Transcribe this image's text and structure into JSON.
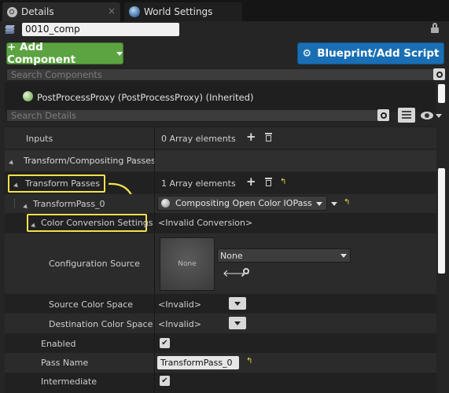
{
  "tabs": [
    {
      "label": "Details",
      "icon": "details-icon"
    },
    {
      "label": "World Settings",
      "icon": "globe-icon"
    }
  ],
  "actor_name": "0010_comp",
  "buttons": {
    "add_component": "+ Add Component",
    "blueprint": "Blueprint/Add Script"
  },
  "search_components_placeholder": "Search Components",
  "component_item": "PostProcessProxy (PostProcessProxy) (Inherited)",
  "search_details_placeholder": "Search Details",
  "properties": {
    "inputs_label": "Inputs",
    "inputs_value": "0 Array elements",
    "category_label": "Transform/Compositing Passes",
    "transform_passes_label": "Transform Passes",
    "transform_passes_value": "1 Array elements",
    "transform_pass0_label": "TransformPass_0",
    "pass_class": "Compositing Open Color IOPass",
    "color_conversion_label": "Color Conversion Settings",
    "color_conversion_value": "<Invalid Conversion>",
    "config_source_label": "Configuration Source",
    "thumbnail_text": "None",
    "config_source_value": "None",
    "source_cs_label": "Source Color Space",
    "source_cs_value": "<Invalid>",
    "dest_cs_label": "Destination Color Space",
    "dest_cs_value": "<Invalid>",
    "enabled_label": "Enabled",
    "enabled_value": true,
    "pass_name_label": "Pass Name",
    "pass_name_value": "TransformPass_0",
    "intermediate_label": "Intermediate",
    "intermediate_value": true
  },
  "colors": {
    "green_button": "#5ca341",
    "blue_button": "#1a6fb4",
    "highlight": "#f2e24c"
  }
}
